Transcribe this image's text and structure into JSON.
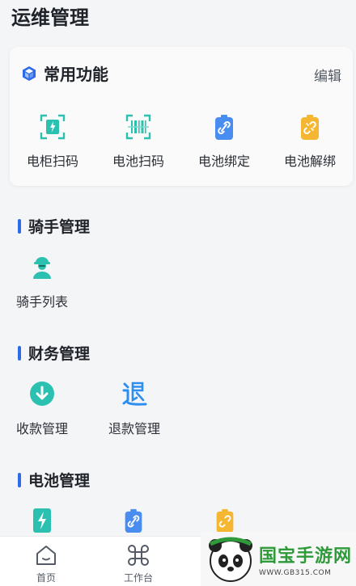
{
  "page": {
    "title": "运维管理"
  },
  "favorites": {
    "title": "常用功能",
    "edit_label": "编辑",
    "items": [
      {
        "label": "电柜扫码",
        "icon": "cabinet-scan-icon"
      },
      {
        "label": "电池扫码",
        "icon": "battery-scan-icon"
      },
      {
        "label": "电池绑定",
        "icon": "battery-bind-icon"
      },
      {
        "label": "电池解绑",
        "icon": "battery-unbind-icon"
      }
    ]
  },
  "sections": {
    "rider": {
      "title": "骑手管理",
      "items": [
        {
          "label": "骑手列表",
          "icon": "rider-icon"
        }
      ]
    },
    "finance": {
      "title": "财务管理",
      "items": [
        {
          "label": "收款管理",
          "icon": "collect-icon"
        },
        {
          "label": "退款管理",
          "icon": "refund-icon"
        }
      ]
    },
    "battery": {
      "title": "电池管理",
      "items": [
        {
          "icon": "battery-charge-icon"
        },
        {
          "icon": "battery-bind-icon"
        },
        {
          "icon": "battery-unbind-icon"
        }
      ]
    }
  },
  "tabbar": {
    "tabs": [
      {
        "label": "首页",
        "icon": "home-icon"
      },
      {
        "label": "工作台",
        "icon": "command-icon"
      }
    ]
  },
  "watermark": {
    "brand": "国宝手游网",
    "url": "WWW.GB315.COM"
  },
  "colors": {
    "accent": "#2e6be6",
    "teal": "#2cc0b0",
    "blue": "#4a8df0",
    "orange": "#f5b731",
    "brand_green": "#2e9a3a"
  }
}
